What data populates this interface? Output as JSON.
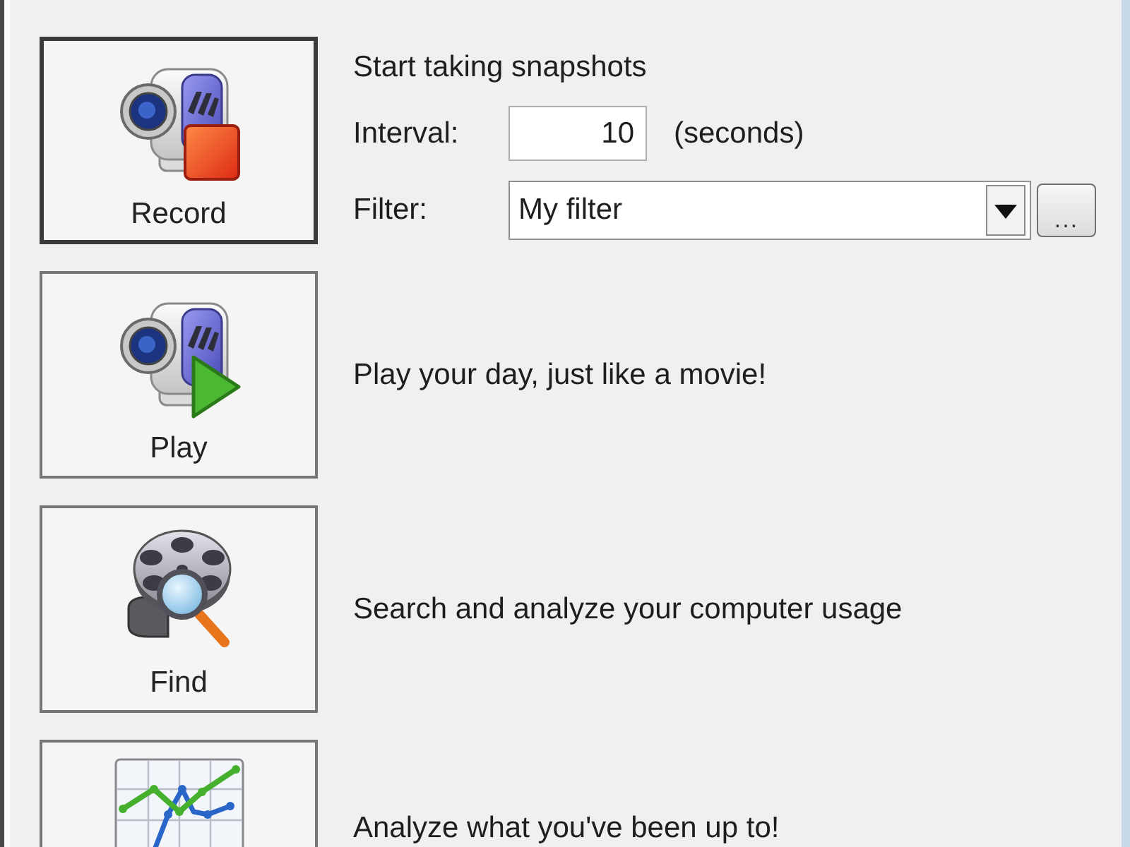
{
  "actions": [
    {
      "kind": "record",
      "label": "Record",
      "focused": true,
      "heading": "Start taking snapshots",
      "settings": [
        {
          "kind": "number",
          "label": "Interval:",
          "value": "10",
          "unit": "(seconds)"
        },
        {
          "kind": "dropdown",
          "label": "Filter:",
          "value": "My filter",
          "more_button": "..."
        }
      ]
    },
    {
      "kind": "play",
      "label": "Play",
      "focused": false,
      "description": "Play your day, just like a movie!"
    },
    {
      "kind": "find",
      "label": "Find",
      "focused": false,
      "description": "Search and analyze your computer usage"
    },
    {
      "kind": "analyze",
      "focused": false,
      "description": "Analyze what you've been up to!"
    }
  ]
}
